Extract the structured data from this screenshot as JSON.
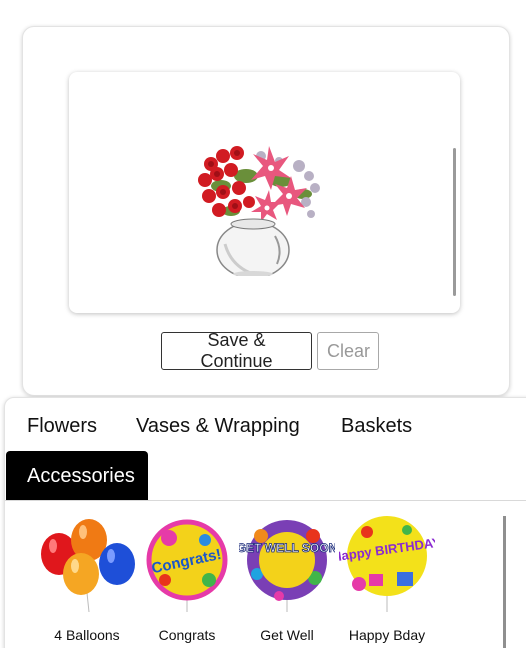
{
  "composer": {
    "save_label": "Save & Continue",
    "clear_label": "Clear"
  },
  "catalog": {
    "tabs": [
      {
        "label": "Flowers",
        "active": false
      },
      {
        "label": "Vases & Wrapping",
        "active": false
      },
      {
        "label": "Baskets",
        "active": false
      },
      {
        "label": "Accessories",
        "active": true
      }
    ],
    "items": [
      {
        "label": "4 Balloons",
        "icon": "balloons-icon"
      },
      {
        "label": "Congrats",
        "icon": "congrats-balloon-icon",
        "art_text": "Congrats!"
      },
      {
        "label": "Get Well",
        "icon": "get-well-balloon-icon",
        "art_text": "GET WELL SOON"
      },
      {
        "label": "Happy Bday",
        "icon": "happy-birthday-balloon-icon",
        "art_text": "Happy BIRTHDAY"
      }
    ]
  },
  "colors": {
    "active_tab_bg": "#000000",
    "active_tab_text": "#ffffff",
    "border": "#e3e3e3"
  }
}
